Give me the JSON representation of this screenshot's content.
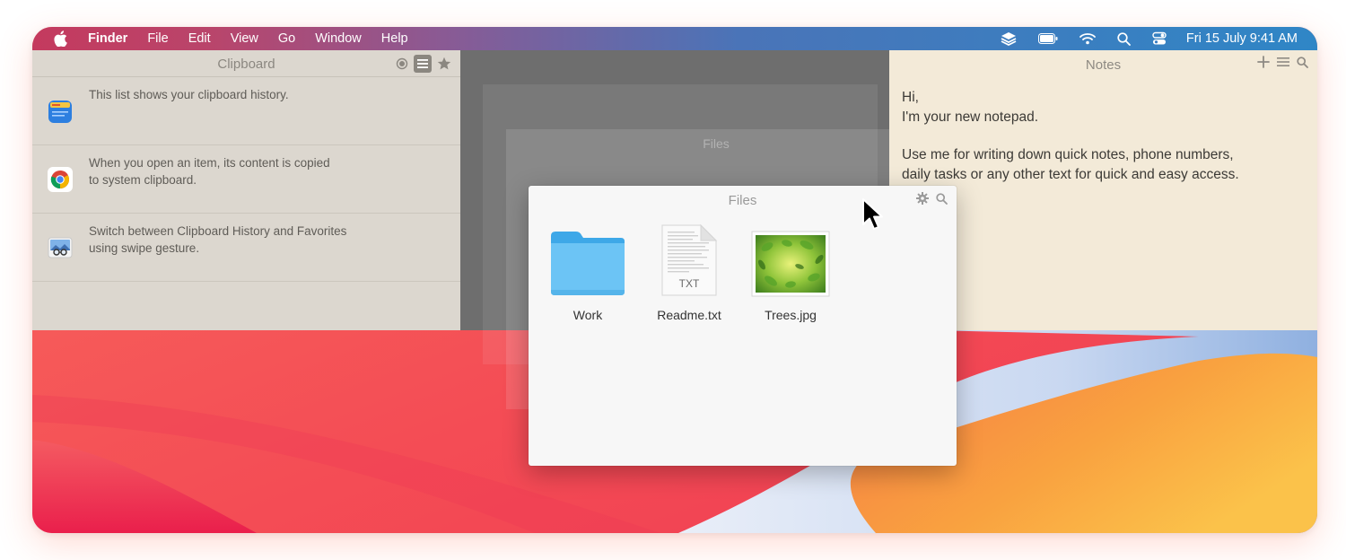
{
  "menubar": {
    "apple_icon": "apple-logo-icon",
    "items": [
      "Finder",
      "File",
      "Edit",
      "View",
      "Go",
      "Window",
      "Help"
    ],
    "status_icons": [
      "stack-icon",
      "battery-icon",
      "wifi-icon",
      "search-icon",
      "control-center-icon"
    ],
    "clock": "Fri 15 July  9:41 AM"
  },
  "clipboard": {
    "title": "Clipboard",
    "controls": [
      "record-icon",
      "list-icon",
      "star-icon"
    ],
    "items": [
      {
        "icon": "notes-app-icon",
        "text_line1": "This list shows your clipboard history.",
        "text_line2": ""
      },
      {
        "icon": "chrome-icon",
        "text_line1": "When you open an item, its content is copied",
        "text_line2": "to system clipboard."
      },
      {
        "icon": "preview-app-icon",
        "text_line1": "Switch between Clipboard History and Favorites",
        "text_line2": "using swipe gesture."
      }
    ]
  },
  "notes": {
    "title": "Notes",
    "controls": [
      "plus-icon",
      "list-icon",
      "search-icon"
    ],
    "lines": [
      "Hi,",
      "I'm your new notepad.",
      "Use me for writing down quick notes, phone numbers,",
      "daily tasks or any other text for quick and easy access."
    ]
  },
  "files": {
    "title": "Files",
    "ghost_title": "Files",
    "controls": [
      "gear-icon",
      "search-icon"
    ],
    "items": [
      {
        "name": "Work",
        "icon": "folder-icon"
      },
      {
        "name": "Readme.txt",
        "icon": "txt-file-icon",
        "badge": "TXT"
      },
      {
        "name": "Trees.jpg",
        "icon": "image-thumbnail-icon"
      }
    ]
  },
  "colors": {
    "clipboard_bg": "#dcd7cf",
    "notes_bg": "#f3ead8",
    "files_bg": "#f7f7f7",
    "folder_blue": "#6cc4f5"
  }
}
